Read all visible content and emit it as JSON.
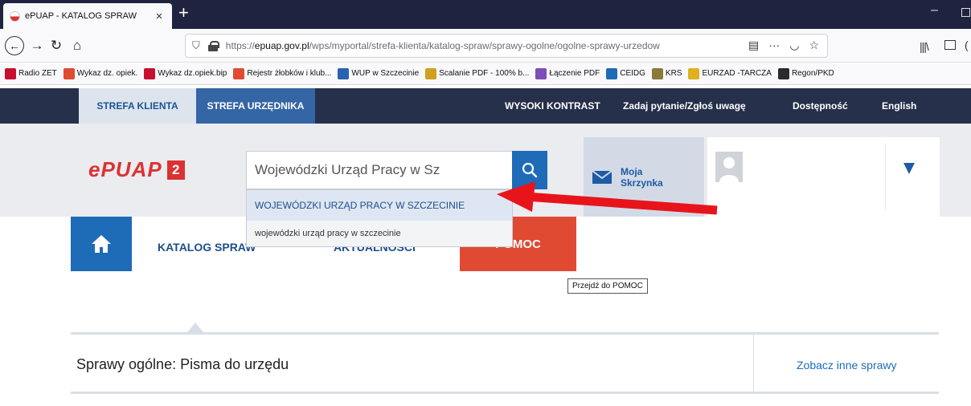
{
  "browser": {
    "tab_title": "ePUAP - KATALOG SPRAW",
    "tab_close": "×",
    "new_tab": "+",
    "url_prefix": "https://",
    "url_host": "epuap.gov.pl",
    "url_path": "/wps/myportal/strefa-klienta/katalog-spraw/sprawy-ogolne/ogolne-sprawy-urzedow",
    "bookmarks": [
      {
        "label": "Radio ZET",
        "color": "#c8102e"
      },
      {
        "label": "Wykaz dz. opiek.",
        "color": "#e04a33"
      },
      {
        "label": "Wykaz dz.opiek.bip",
        "color": "#c8102e"
      },
      {
        "label": "Rejestr żłobków i klub...",
        "color": "#e04a33"
      },
      {
        "label": "WUP w Szczecinie",
        "color": "#2a62b0"
      },
      {
        "label": "Scalanie PDF - 100% b...",
        "color": "#d0a020"
      },
      {
        "label": "Łączenie PDF",
        "color": "#7b4fb5"
      },
      {
        "label": "CEIDG",
        "color": "#1e6bb8"
      },
      {
        "label": "KRS",
        "color": "#8a7a3c"
      },
      {
        "label": "EURZAD -TARCZA",
        "color": "#e0b020"
      },
      {
        "label": "Regon/PKD",
        "color": "#2b2b2b"
      }
    ]
  },
  "topbar": {
    "strefa_klienta": "STREFA KLIENTA",
    "strefa_urzednika": "STREFA URZĘDNIKA",
    "wysoki_kontrast": "WYSOKI KONTRAST",
    "zadaj_pytanie": "Zadaj pytanie/Zgłoś uwagę",
    "dostepnosc": "Dostępność",
    "english": "English"
  },
  "header": {
    "logo_text": "ePUAP",
    "logo_badge": "2",
    "search_value": "Wojewódzki Urząd Pracy w Sz",
    "inbox_line1": "Moja",
    "inbox_line2": "Skrzynka"
  },
  "autocomplete": {
    "item1": "WOJEWÓDZKI URZĄD PRACY W SZCZECINIE",
    "item2": "wojewódzki urząd pracy w szczecinie"
  },
  "tiles": {
    "katalog": "KATALOG SPRAW",
    "aktualnosci": "AKTUALNOŚCI",
    "pomoc": "POMOC"
  },
  "tooltip": "Przejdź do POMOC",
  "section": {
    "title": "Sprawy ogólne: Pisma do urzędu",
    "link": "Zobacz inne sprawy"
  },
  "colors": {
    "brand_red": "#dc3232",
    "brand_blue": "#1e6bb8",
    "topbar_dark": "#26304a",
    "annotation_arrow": "#e8141c"
  }
}
